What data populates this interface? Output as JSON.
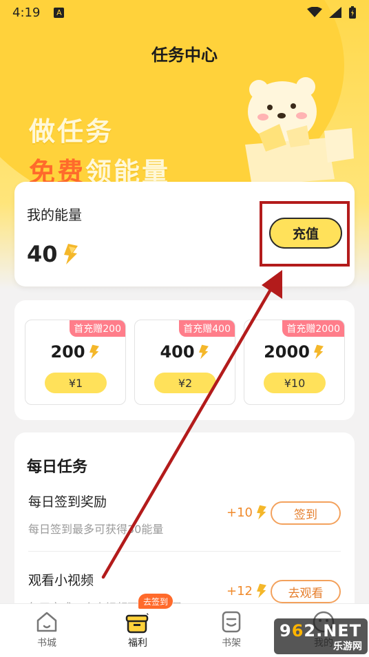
{
  "status_bar": {
    "time": "4:19",
    "notification_badge": "A"
  },
  "page_title": "任务中心",
  "slogan": {
    "line1": "做任务",
    "line2_highlight": "免费",
    "line2_rest": "领能量"
  },
  "energy_card": {
    "label": "我的能量",
    "value": "40",
    "recharge_label": "充值"
  },
  "packages": [
    {
      "badge": "首充赠200",
      "amount": "200",
      "price": "¥1"
    },
    {
      "badge": "首充赠400",
      "amount": "400",
      "price": "¥2"
    },
    {
      "badge": "首充赠2000",
      "amount": "2000",
      "price": "¥10"
    }
  ],
  "daily": {
    "title": "每日任务",
    "tasks": [
      {
        "name": "每日签到奖励",
        "desc": "每日签到最多可获得30能量",
        "reward": "+10",
        "action": "签到"
      },
      {
        "name": "观看小视频",
        "desc": "每天完成一个小视频可获得能量",
        "reward": "+12",
        "action": "去观看"
      }
    ]
  },
  "bottom_nav": {
    "bubble": "去签到",
    "items": [
      {
        "label": "书城",
        "icon": "house-icon"
      },
      {
        "label": "福利",
        "icon": "gift-basket-icon"
      },
      {
        "label": "书架",
        "icon": "book-icon"
      },
      {
        "label": "我的",
        "icon": "smiley-icon"
      }
    ]
  },
  "watermark": {
    "top_prefix": "9",
    "top_mid": "6",
    "top_suffix": "2.NET",
    "bottom": "乐游网"
  },
  "colors": {
    "primary": "#ffd23b",
    "accent_orange": "#ff6a2b",
    "highlight_box": "#b31b1b"
  }
}
